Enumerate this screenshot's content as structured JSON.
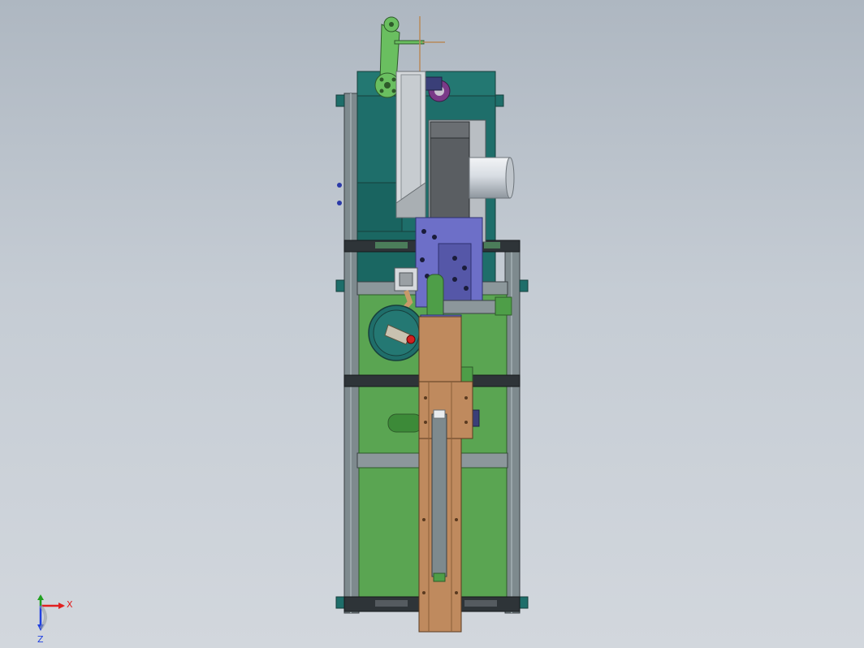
{
  "triad": {
    "x_label": "X",
    "z_label": "Z",
    "x_color": "#e02020",
    "y_color": "#20a020",
    "z_color": "#2040e0"
  },
  "colors": {
    "frame_teal": "#1e6e6a",
    "frame_gray": "#7e8a8e",
    "frame_dark": "#2e3438",
    "plate_green": "#5aa552",
    "plate_wood": "#bf8a5e",
    "plate_purple": "#6d6fc8",
    "dark_gray": "#5a5e62",
    "cylinder": "#d8dde3"
  }
}
